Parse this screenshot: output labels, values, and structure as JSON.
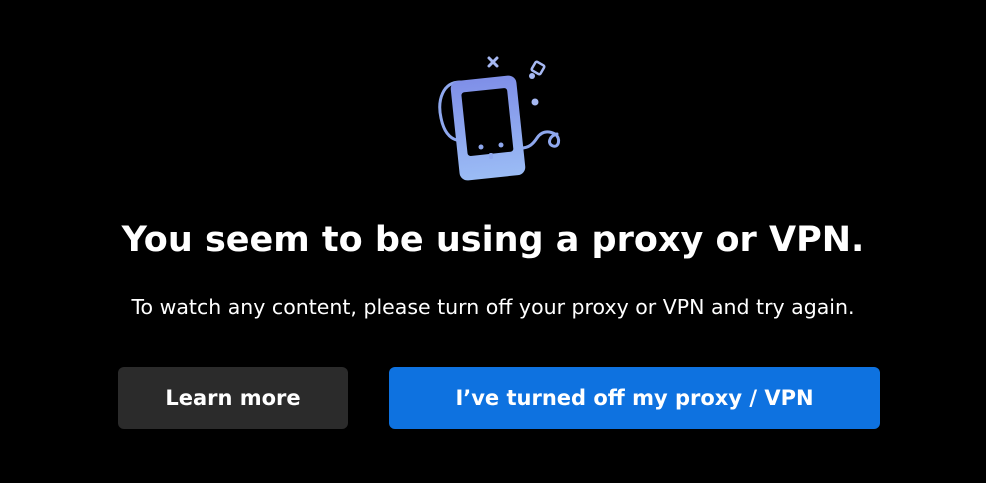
{
  "dialog": {
    "illustration_icon": "vpn-phone-illustration-icon",
    "title": "You seem to be using a proxy or VPN.",
    "message": "To watch any content, please turn off your proxy or VPN and try again."
  },
  "actions": {
    "learn_more_label": "Learn more",
    "confirm_label": "I’ve turned off my proxy / VPN"
  },
  "colors": {
    "background": "#000000",
    "text": "#ffffff",
    "secondary_button": "#2b2b2b",
    "primary_button": "#0e72e0",
    "illustration_accent": "#8aa7f0"
  }
}
